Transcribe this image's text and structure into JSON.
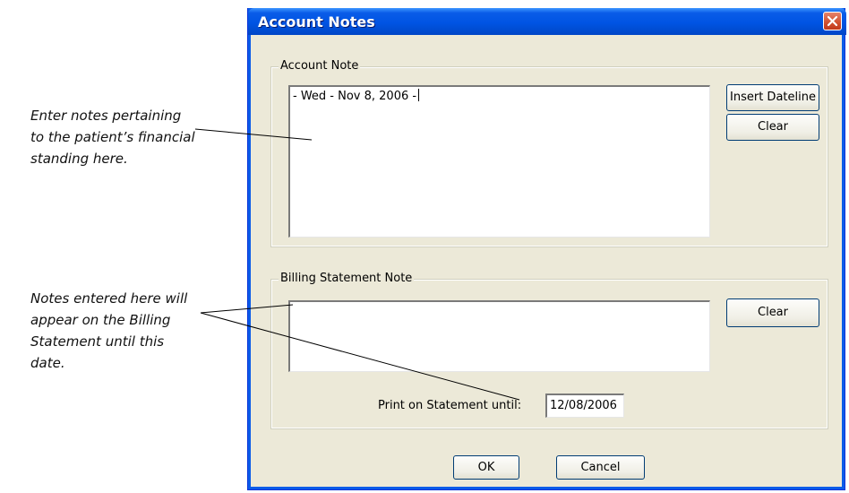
{
  "callouts": {
    "account": [
      "Enter notes pertaining",
      "to the patient’s financial",
      "standing here."
    ],
    "billing": [
      "Notes entered here will",
      "appear on the Billing",
      "Statement until this",
      "date."
    ]
  },
  "dialog": {
    "title": "Account Notes",
    "account_group": {
      "legend": "Account Note",
      "note_text": "- Wed - Nov 8, 2006 -",
      "insert_dateline_label": "Insert Dateline",
      "clear_label": "Clear"
    },
    "billing_group": {
      "legend": "Billing Statement Note",
      "note_text": "",
      "clear_label": "Clear",
      "print_until_label": "Print on Statement until:",
      "print_until_value": "12/08/2006"
    },
    "ok_label": "OK",
    "cancel_label": "Cancel"
  },
  "colors": {
    "titlebar": "#0054e3",
    "dialog_bg": "#ece9d8",
    "close_button": "#d1502f"
  },
  "icons": {
    "close": "close-icon"
  }
}
